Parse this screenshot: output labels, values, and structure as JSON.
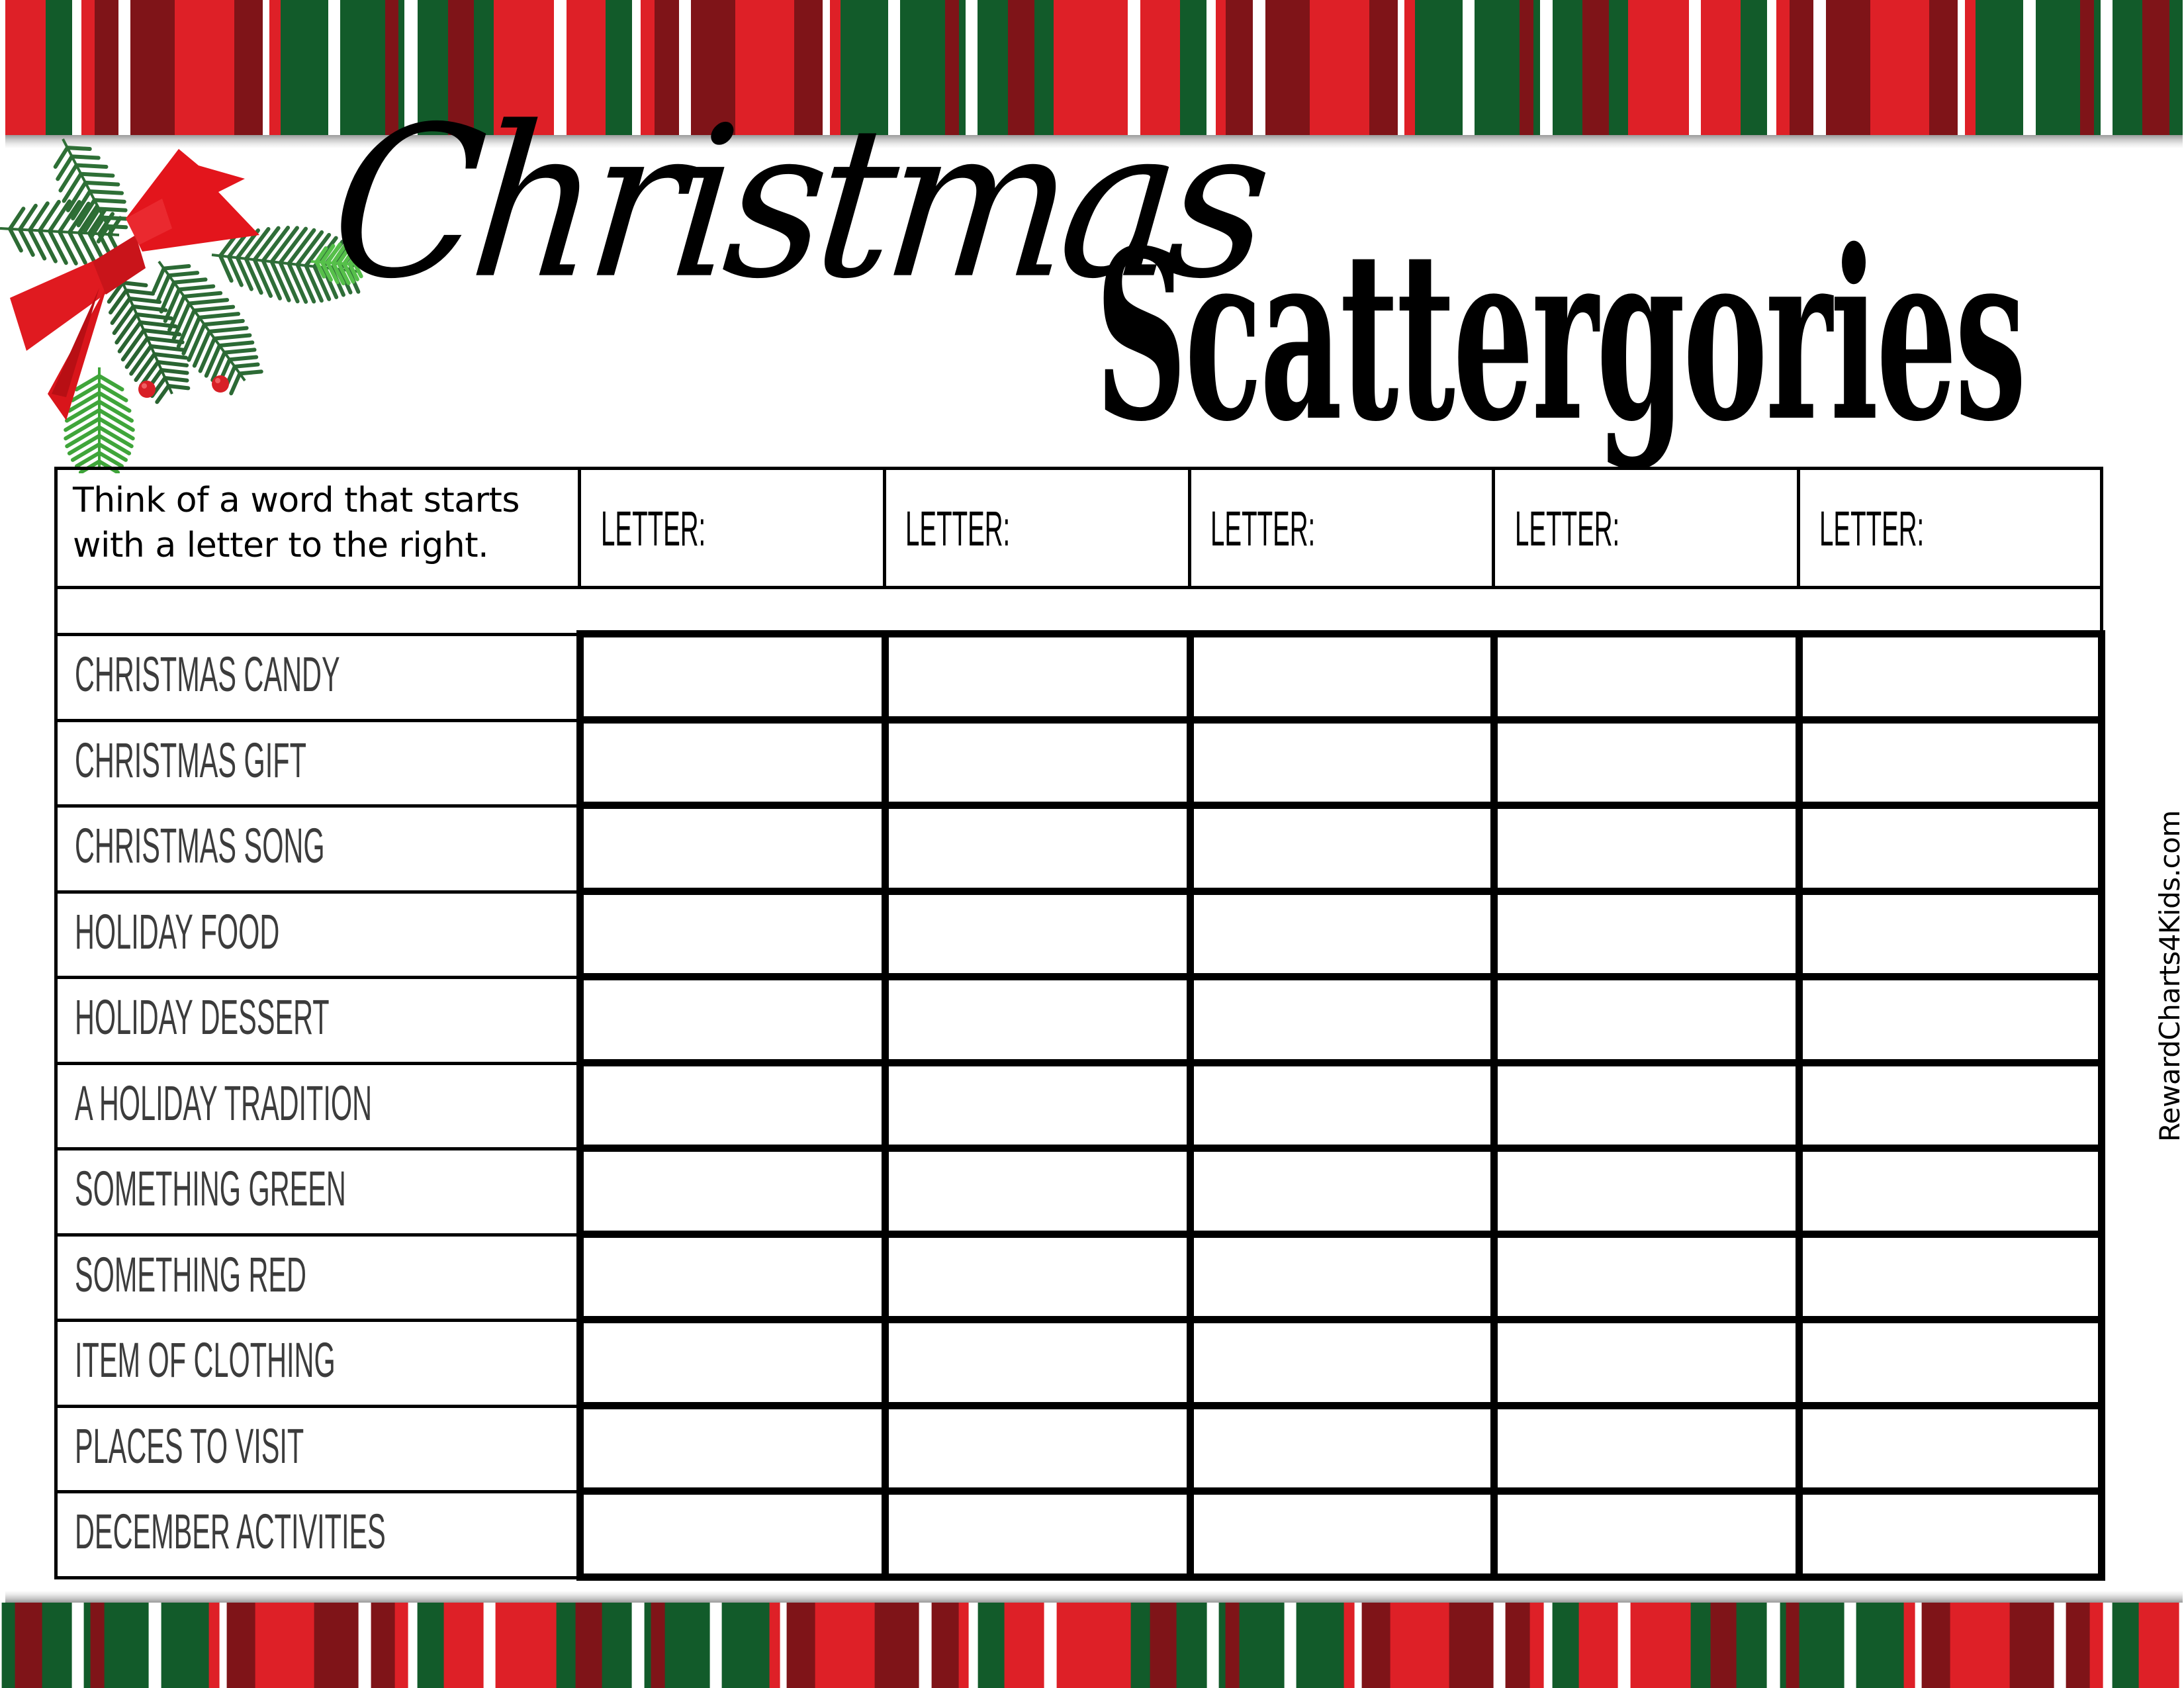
{
  "page": {
    "title_script": "Christmas",
    "title_main": "Scattergories",
    "watermark": "RewardCharts4Kids.com"
  },
  "colors": {
    "red": "#DE2027",
    "dark_red": "#7F1418",
    "green": "#125B2A",
    "white": "#FFFFFF",
    "label_text": "#3C3C3C",
    "grid_line": "#000000"
  },
  "table": {
    "instructions": "Think of a word that starts with a letter to the right.",
    "instructions_lines": [
      "Think of a word that starts",
      "with a letter to the right."
    ],
    "letter_headers": [
      "LETTER:",
      "LETTER:",
      "LETTER:",
      "LETTER:",
      "LETTER:"
    ],
    "categories": [
      "CHRISTMAS CANDY",
      "CHRISTMAS GIFT",
      "CHRISTMAS SONG",
      "HOLIDAY FOOD",
      "HOLIDAY DESSERT",
      "A HOLIDAY TRADITION",
      "SOMETHING GREEN",
      "SOMETHING RED",
      "ITEM OF CLOTHING",
      "PLACES TO VISIT",
      "DECEMBER ACTIVITIES"
    ],
    "answers": [
      [
        "",
        "",
        "",
        "",
        ""
      ],
      [
        "",
        "",
        "",
        "",
        ""
      ],
      [
        "",
        "",
        "",
        "",
        ""
      ],
      [
        "",
        "",
        "",
        "",
        ""
      ],
      [
        "",
        "",
        "",
        "",
        ""
      ],
      [
        "",
        "",
        "",
        "",
        ""
      ],
      [
        "",
        "",
        "",
        "",
        ""
      ],
      [
        "",
        "",
        "",
        "",
        ""
      ],
      [
        "",
        "",
        "",
        "",
        ""
      ],
      [
        "",
        "",
        "",
        "",
        ""
      ],
      [
        "",
        "",
        "",
        "",
        ""
      ]
    ]
  },
  "decorations": {
    "top_border": "striped-ribbon-border",
    "bottom_border": "striped-ribbon-border",
    "corner_ornament": "pine-branch-with-red-bow-and-berries"
  }
}
